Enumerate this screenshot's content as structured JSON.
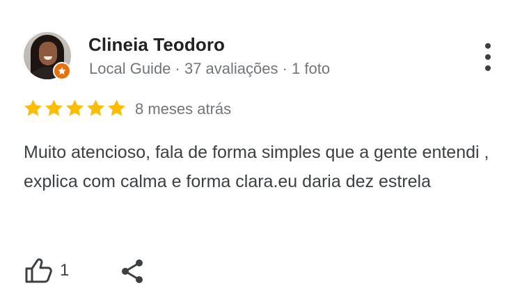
{
  "reviewer": {
    "name": "Clineia Teodoro",
    "subtitle": "Local Guide · 37 avaliações · 1 foto",
    "badge": "local-guide-star-icon"
  },
  "rating": {
    "stars": 5,
    "max": 5,
    "star_color": "#fbbc04",
    "date": "8 meses atrás"
  },
  "review": {
    "text": "Muito atencioso, fala de forma simples que a gente entendi , explica com calma e forma clara.eu daria dez estrela"
  },
  "actions": {
    "like_icon": "thumbs-up-icon",
    "like_count": "1",
    "share_icon": "share-icon",
    "more_icon": "more-vert-icon"
  },
  "colors": {
    "badge": "#e8710a",
    "secondary_text": "#70757a"
  }
}
